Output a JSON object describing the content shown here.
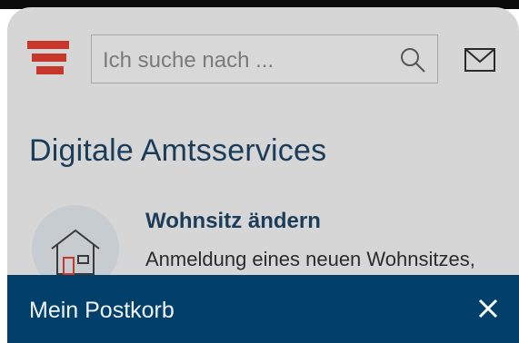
{
  "header": {
    "search_placeholder": "Ich suche nach ...",
    "icons": {
      "logo": "austria-flag-logo",
      "search": "search-icon",
      "mail": "mail-icon"
    }
  },
  "main": {
    "title": "Digitale Amtsservices",
    "service": {
      "title": "Wohnsitz ändern",
      "description": "Anmeldung eines neuen Wohnsitzes,",
      "icon": "house-icon"
    }
  },
  "bottom_bar": {
    "label": "Mein Postkorb",
    "close_icon": "close-icon"
  },
  "colors": {
    "brand_red": "#c7372c",
    "navy": "#023f6b",
    "title_blue": "#1c3d5a",
    "overlay_gray": "#d6d6d6"
  }
}
